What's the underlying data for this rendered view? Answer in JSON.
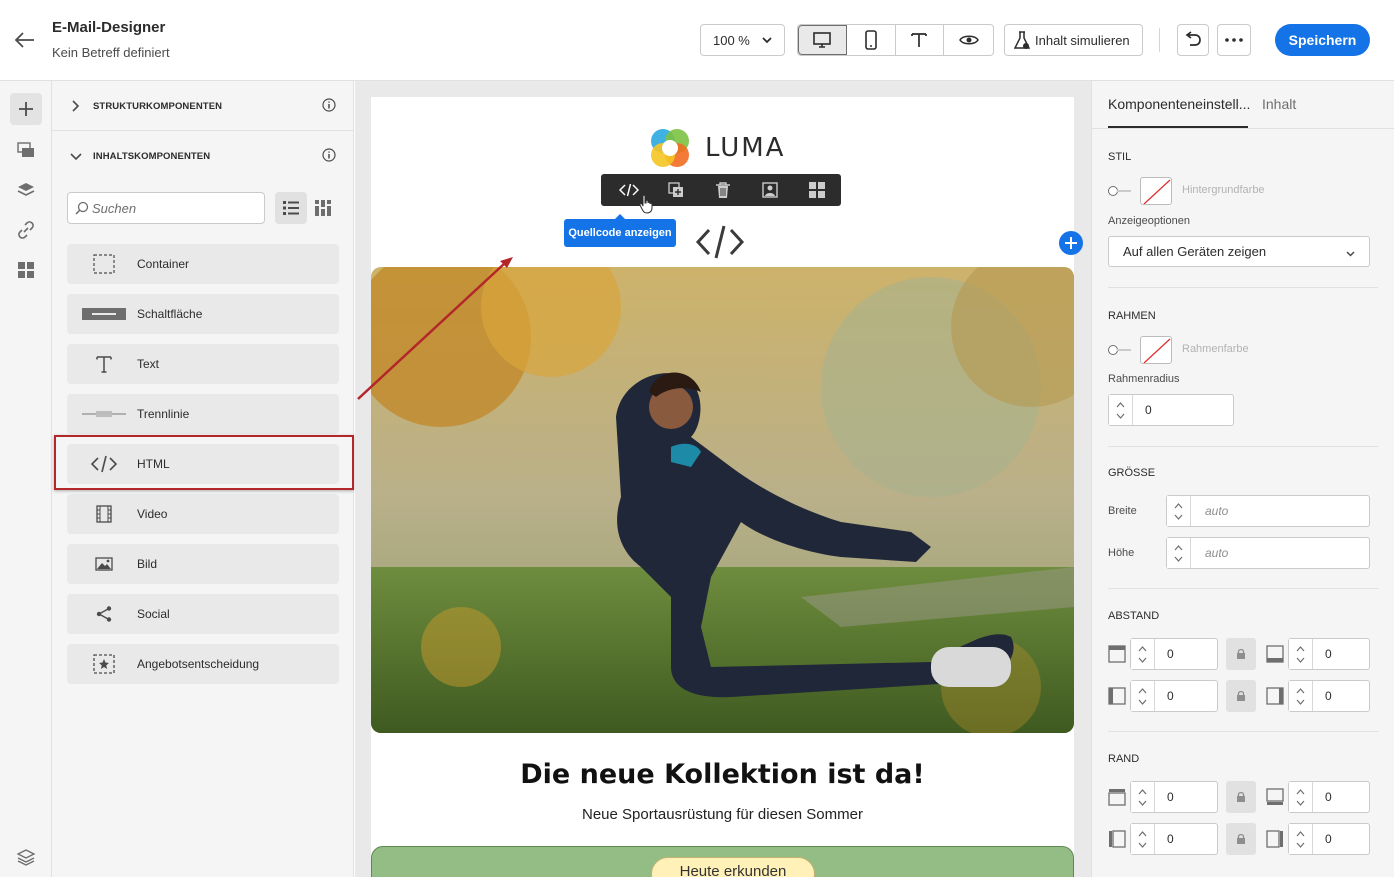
{
  "header": {
    "title": "E-Mail-Designer",
    "subtitle": "Kein Betreff definiert",
    "zoom": "100 %",
    "simulate_label": "Inhalt simulieren",
    "save_label": "Speichern"
  },
  "left_panel": {
    "structure_section": "STRUKTURKOMPONENTEN",
    "content_section": "INHALTSKOMPONENTEN",
    "search_placeholder": "Suchen",
    "components": [
      {
        "label": "Container",
        "icon": "container-icon"
      },
      {
        "label": "Schaltfläche",
        "icon": "button-icon"
      },
      {
        "label": "Text",
        "icon": "text-icon"
      },
      {
        "label": "Trennlinie",
        "icon": "divider-icon"
      },
      {
        "label": "HTML",
        "icon": "html-icon"
      },
      {
        "label": "Video",
        "icon": "video-icon"
      },
      {
        "label": "Bild",
        "icon": "image-icon"
      },
      {
        "label": "Social",
        "icon": "share-icon"
      },
      {
        "label": "Angebotsentscheidung",
        "icon": "offer-icon"
      }
    ]
  },
  "canvas": {
    "logo_text": "LUMA",
    "tooltip": "Quellcode anzeigen",
    "headline": "Die neue Kollektion ist da!",
    "subheadline": "Neue Sportausrüstung für diesen Sommer",
    "cta_label": "Heute erkunden"
  },
  "right_panel": {
    "tab_settings": "Komponenteneinstell...",
    "tab_content": "Inhalt",
    "style_title": "STIL",
    "background_color_label": "Hintergrundfarbe",
    "display_options_label": "Anzeigeoptionen",
    "display_option_value": "Auf allen Geräten zeigen",
    "border_title": "RAHMEN",
    "border_color_label": "Rahmenfarbe",
    "border_radius_label": "Rahmenradius",
    "border_radius_value": "0",
    "size_title": "GRÖSSE",
    "width_label": "Breite",
    "width_placeholder": "auto",
    "height_label": "Höhe",
    "height_placeholder": "auto",
    "padding_title": "ABSTAND",
    "padding_top": "0",
    "padding_bottom": "0",
    "padding_left": "0",
    "padding_right": "0",
    "margin_title": "RAND",
    "margin_top": "0",
    "margin_bottom": "0",
    "margin_left": "0",
    "margin_right": "0"
  },
  "colors": {
    "accent": "#1473e6",
    "highlight_box": "#b3262a",
    "cta_band": "#94bd86",
    "cta_button": "#fff1b8"
  }
}
